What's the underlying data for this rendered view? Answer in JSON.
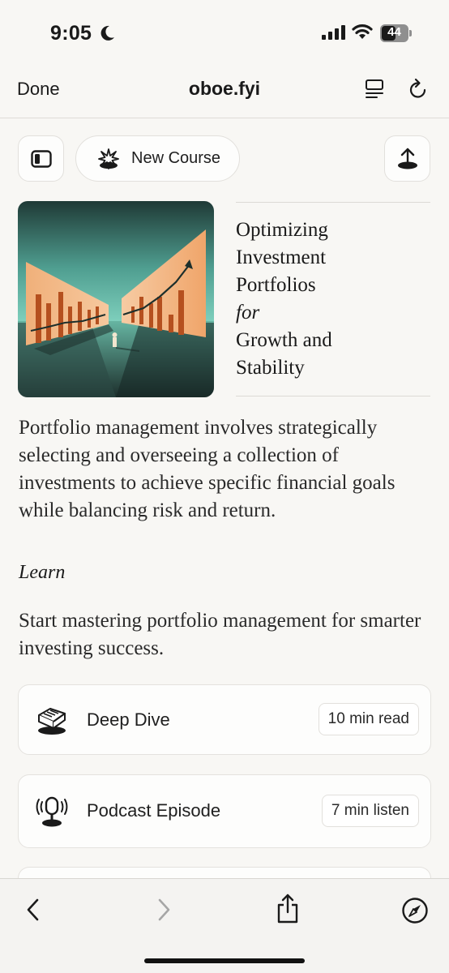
{
  "status_bar": {
    "time": "9:05",
    "battery": "44",
    "icons": [
      "moon-icon",
      "signal-icon",
      "wifi-icon",
      "battery-icon"
    ]
  },
  "nav": {
    "done_label": "Done",
    "title": "oboe.fyi",
    "icons": [
      "reader-icon",
      "reload-icon"
    ]
  },
  "toolbar": {
    "new_course_label": "New Course",
    "icons": [
      "sidebar-icon",
      "sparkle-icon",
      "upload-icon"
    ]
  },
  "hero": {
    "title_lines": [
      "Optimizing",
      "Investment",
      "Portfolios",
      "for",
      "Growth and",
      "Stability"
    ],
    "image_icon": "investment-chart-illustration"
  },
  "description": "Portfolio management involves strategically selecting and overseeing a collection of investments to achieve specific financial goals while balancing risk and return.",
  "learn": {
    "heading": "Learn",
    "subtitle": "Start mastering portfolio management for smarter investing success."
  },
  "cards": [
    {
      "title": "Deep Dive",
      "badge": "10 min read",
      "icon": "book-icon"
    },
    {
      "title": "Podcast Episode",
      "badge": "7 min listen",
      "icon": "microphone-icon"
    }
  ],
  "bottom_bar": {
    "icons": [
      "back-icon",
      "forward-icon",
      "share-icon",
      "compass-icon"
    ]
  },
  "colors": {
    "background": "#f8f7f4",
    "text": "#1a1a1a",
    "hero_teal": "#5fb5a6",
    "hero_orange": "#e8894a"
  }
}
